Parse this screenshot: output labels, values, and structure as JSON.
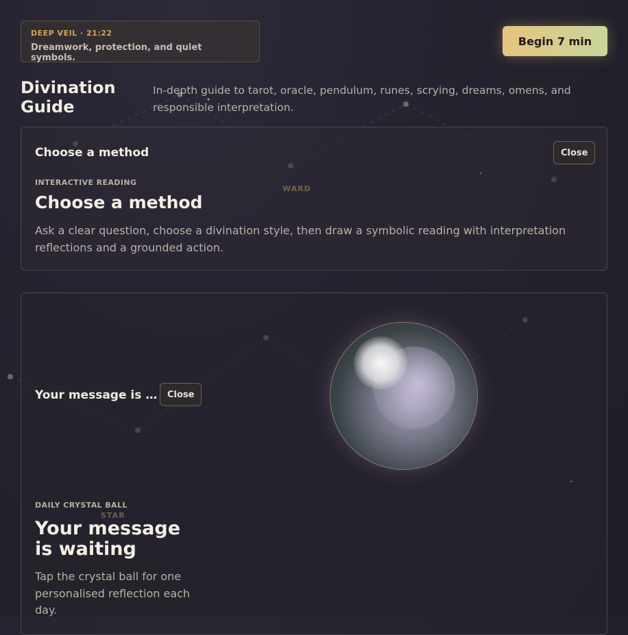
{
  "header": {
    "kicker": "DEEP VEIL · 21:22",
    "tagline": "Dreamwork, protection, and quiet symbols.",
    "begin_label": "Begin 7 min"
  },
  "page": {
    "title": "Divination Guide",
    "subtitle": "In-depth guide to tarot, oracle, pendulum, runes, scrying, dreams, omens, and responsible interpretation."
  },
  "method_panel": {
    "header": "Choose a method",
    "close_label": "Close",
    "eyebrow": "INTERACTIVE READING",
    "heading": "Choose a method",
    "description": "Ask a clear question, choose a divination style, then draw a symbolic reading with interpretation reflections and a grounded action."
  },
  "message_panel": {
    "header": "Your message is …",
    "close_label": "Close",
    "eyebrow": "DAILY CRYSTAL BALL",
    "heading": "Your message is waiting",
    "description": "Tap the crystal ball for one personalised reflection each day."
  },
  "constellation_labels": {
    "ward": "WARD",
    "moon": "MOON",
    "star": "STAR"
  },
  "colors": {
    "accent_gold": "#d8a45a",
    "button_gradient_start": "#e6c47e",
    "button_gradient_end": "#c9d59c"
  }
}
